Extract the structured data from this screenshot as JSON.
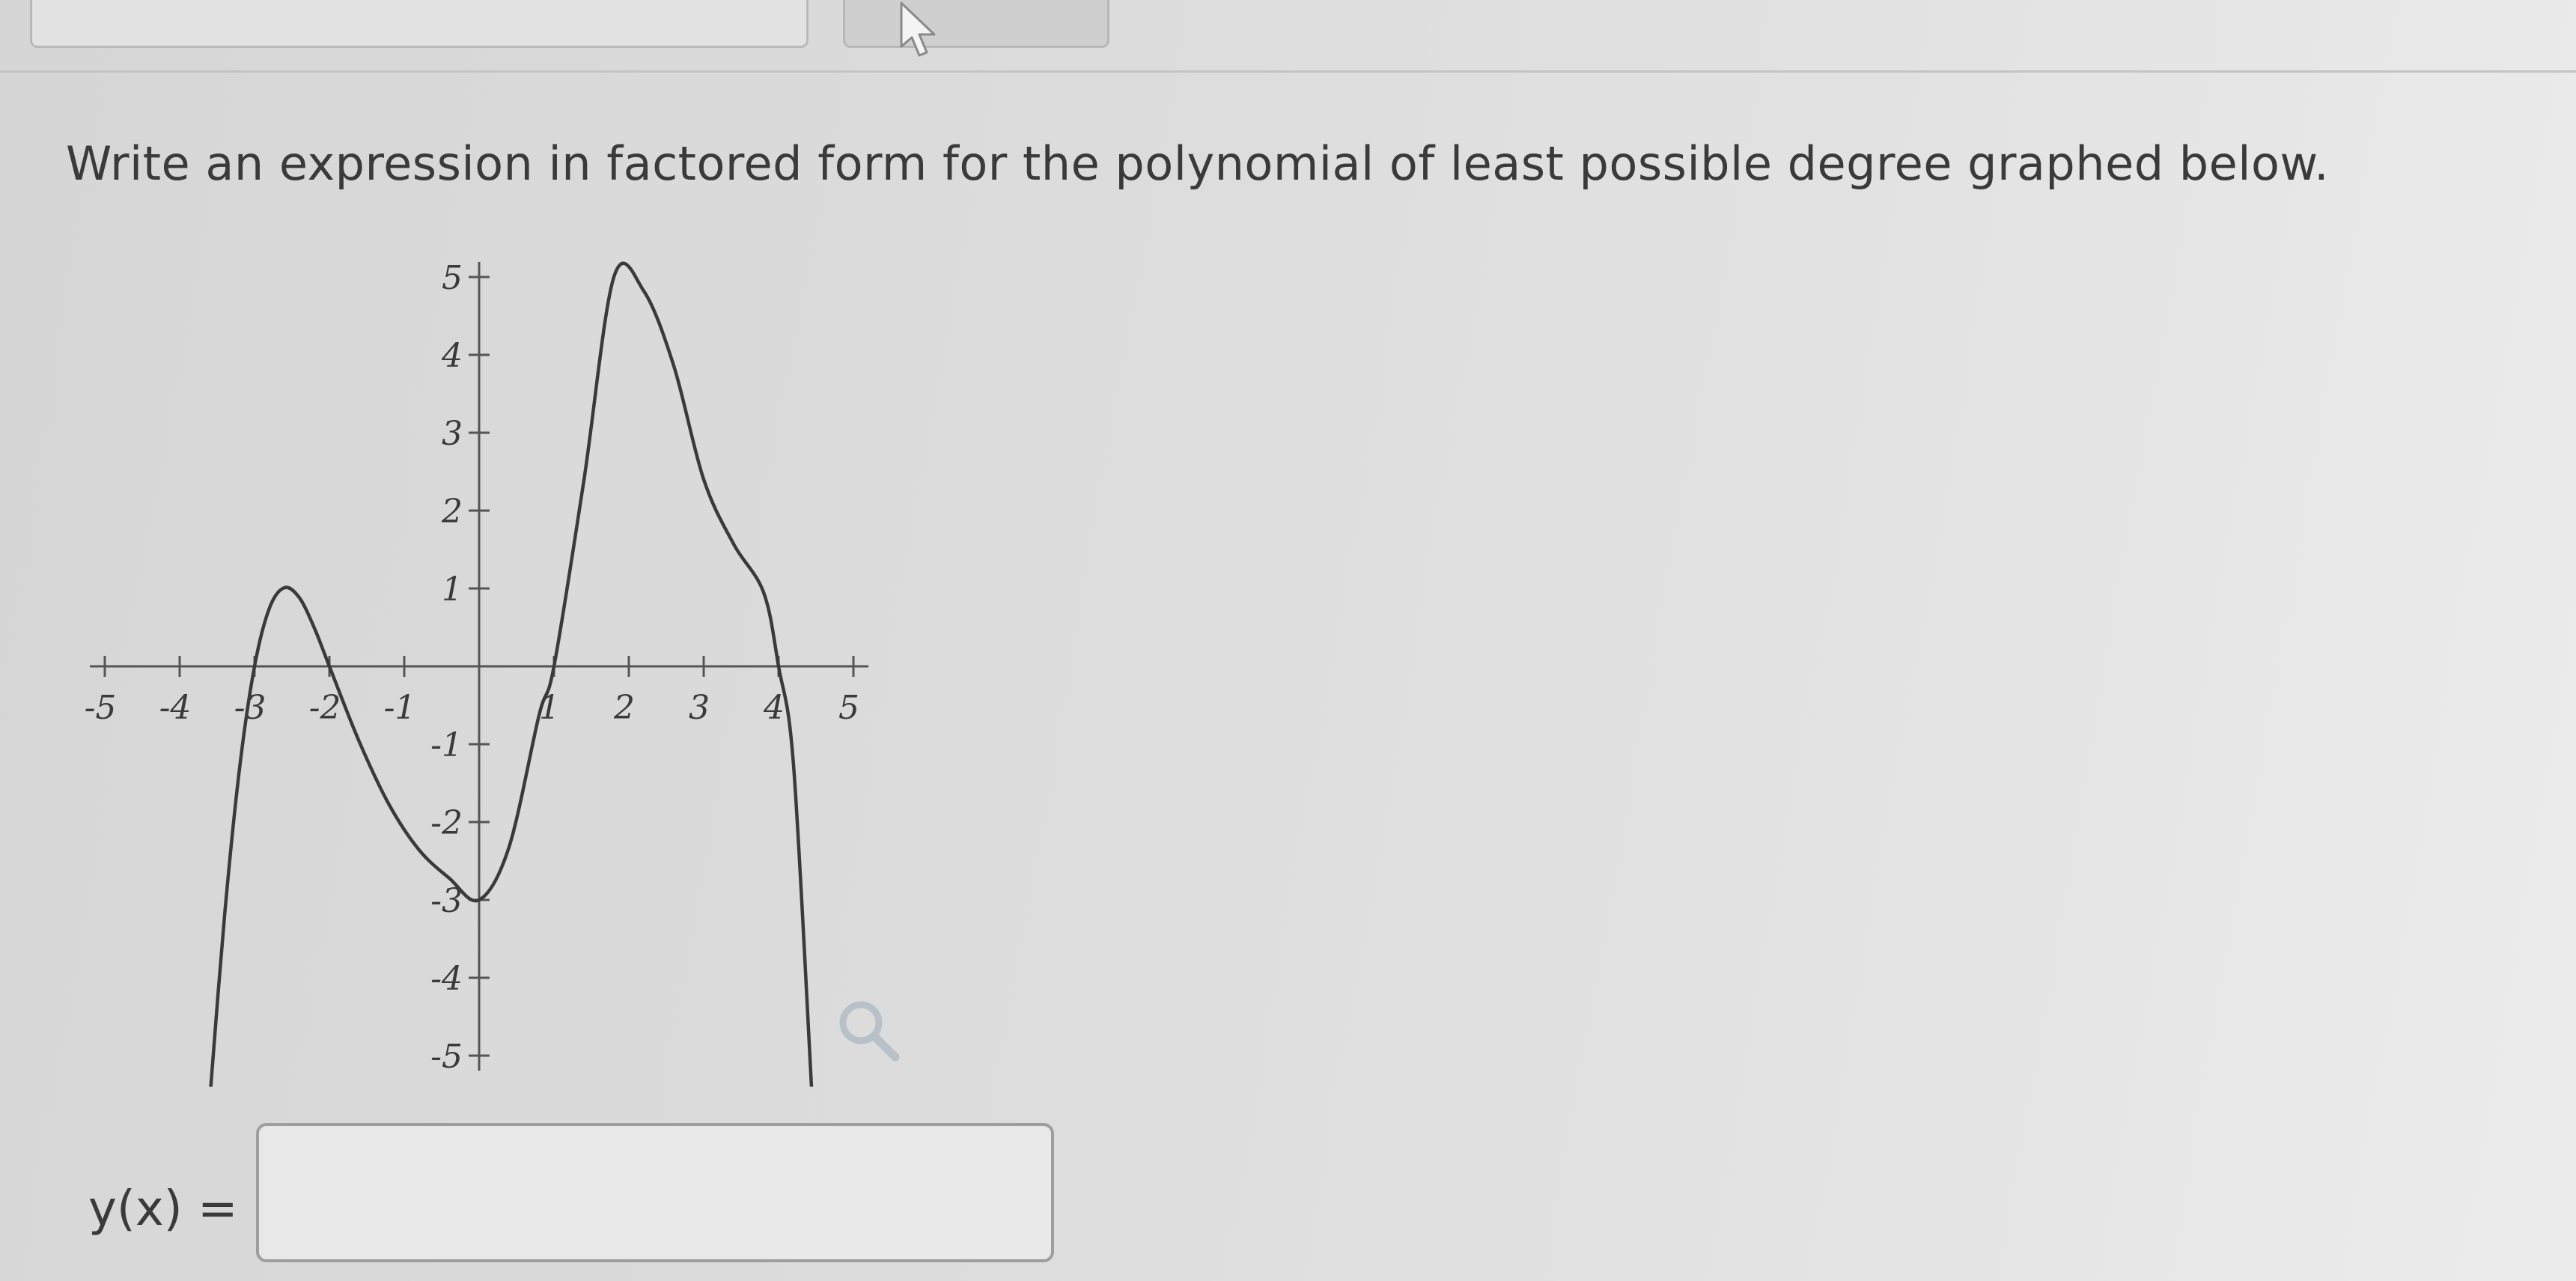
{
  "question": {
    "text": "Write an expression in factored form for the polynomial of least possible degree graphed below."
  },
  "answer": {
    "label": "y(x) =",
    "value": "",
    "placeholder": ""
  },
  "icons": {
    "cursor": "mouse-cursor-icon",
    "zoom": "magnifier-zoom-icon"
  },
  "chart_data": {
    "type": "line",
    "xlim": [
      -5,
      5
    ],
    "ylim": [
      -5,
      5
    ],
    "x_ticks": [
      -5,
      -4,
      -3,
      -2,
      -1,
      1,
      2,
      3,
      4,
      5
    ],
    "x_tick_labels": [
      "-5",
      "-4",
      "-3",
      "-2",
      "-1",
      "1",
      "2",
      "3",
      "4",
      "5"
    ],
    "y_ticks": [
      -5,
      -4,
      -3,
      -2,
      -1,
      1,
      2,
      3,
      4,
      5
    ],
    "y_tick_labels": [
      "-5",
      "-4",
      "-3",
      "-2",
      "-1",
      "1",
      "2",
      "3",
      "4",
      "5"
    ],
    "x_intercepts": [
      -3,
      -2,
      1,
      4
    ],
    "y_intercept": -3,
    "series": [
      {
        "x": [
          -3.6,
          -3.4,
          -3.2,
          -3.0,
          -2.8,
          -2.6,
          -2.4,
          -2.2,
          -2.0,
          -1.6,
          -1.2,
          -0.8,
          -0.4,
          0.0,
          0.4,
          0.8,
          1.0,
          1.4,
          1.8,
          2.2,
          2.6,
          3.0,
          3.4,
          3.8,
          4.0,
          4.2,
          4.44
        ],
        "y": [
          -5.59,
          -3.2,
          -1.31,
          0.0,
          0.75,
          1.01,
          0.88,
          0.49,
          0.0,
          -0.97,
          -1.78,
          -2.36,
          -2.72,
          -3.0,
          -2.32,
          -0.63,
          0.0,
          2.39,
          5.0,
          4.82,
          3.86,
          2.4,
          1.57,
          0.95,
          0.0,
          -1.27,
          -5.4
        ]
      }
    ],
    "grid": false,
    "color": "#3a3a3a"
  }
}
